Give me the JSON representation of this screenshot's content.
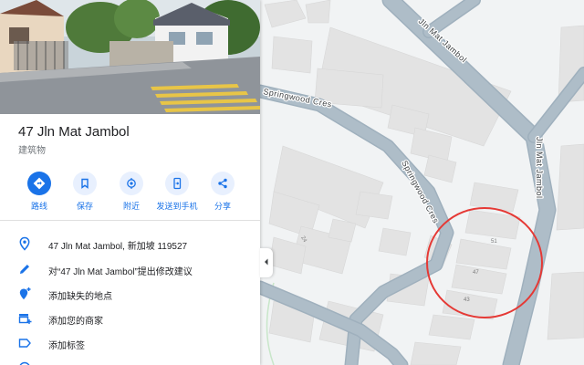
{
  "place": {
    "title": "47 Jln Mat Jambol",
    "category": "建筑物"
  },
  "actions": [
    {
      "label": "路线",
      "icon": "directions-icon"
    },
    {
      "label": "保存",
      "icon": "bookmark-icon"
    },
    {
      "label": "附近",
      "icon": "nearby-icon"
    },
    {
      "label": "发送到手机",
      "icon": "send-to-phone-icon"
    },
    {
      "label": "分享",
      "icon": "share-icon"
    }
  ],
  "info": {
    "address": "47 Jln Mat Jambol, 新加坡 119527",
    "suggest_edit": "对“47 Jln Mat Jambol”提出修改建议",
    "add_missing_place": "添加缺失的地点",
    "add_business": "添加您的商家",
    "add_label": "添加标签"
  },
  "map": {
    "streets": {
      "jln_mat_jambol_top": "Jln Mat Jambol",
      "jln_mat_jambol_right": "Jln Mat Jambol",
      "springwood_top": "Springwood Cres",
      "springwood_middle": "Springwood Cres"
    },
    "house_numbers": [
      "51",
      "47",
      "43",
      "24"
    ]
  },
  "colors": {
    "accent": "#1a73e8",
    "highlight_circle": "#e53935",
    "road": "#aebdc8",
    "building": "#e6e6e6"
  }
}
